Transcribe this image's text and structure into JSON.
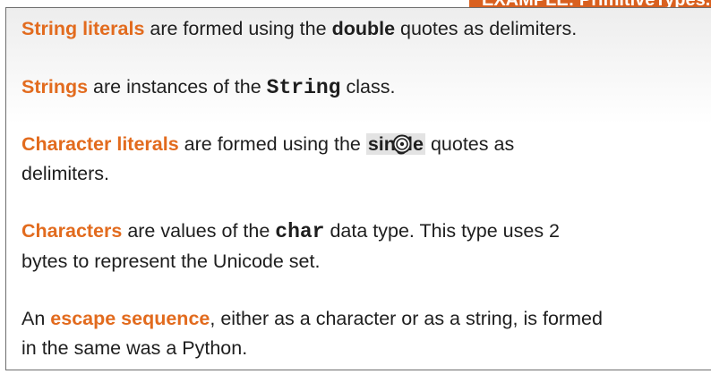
{
  "example_tab": {
    "label": "EXAMPLE: PrimitiveTypes.ja"
  },
  "paragraphs": {
    "p1": {
      "term": "String literals",
      "t1": " are formed using the ",
      "bold": "double",
      "t2": " quotes as delimiters."
    },
    "p2": {
      "term": "Strings",
      "t1": " are instances of the ",
      "code": "String",
      "t2": " class."
    },
    "p3": {
      "term": "Character literals",
      "t1": " are formed using the ",
      "selected": "single",
      "t2": " quotes as",
      "line2": "delimiters."
    },
    "p4": {
      "term": "Characters",
      "t1": " are values of the ",
      "code": "char",
      "t2": " data type. This type uses 2",
      "line2": "bytes to represent the Unicode set."
    },
    "p5": {
      "t0": "An ",
      "term": "escape sequence",
      "t1": ", either as a character or as a string, is formed",
      "line2": "in the same was a Python."
    }
  },
  "colors": {
    "accent": "#e26b1e",
    "tab": "#d9601f",
    "text": "#1e1e1e",
    "selection": "#e3e3e3"
  },
  "icons": {
    "cursor": "zoom-cursor-icon"
  }
}
